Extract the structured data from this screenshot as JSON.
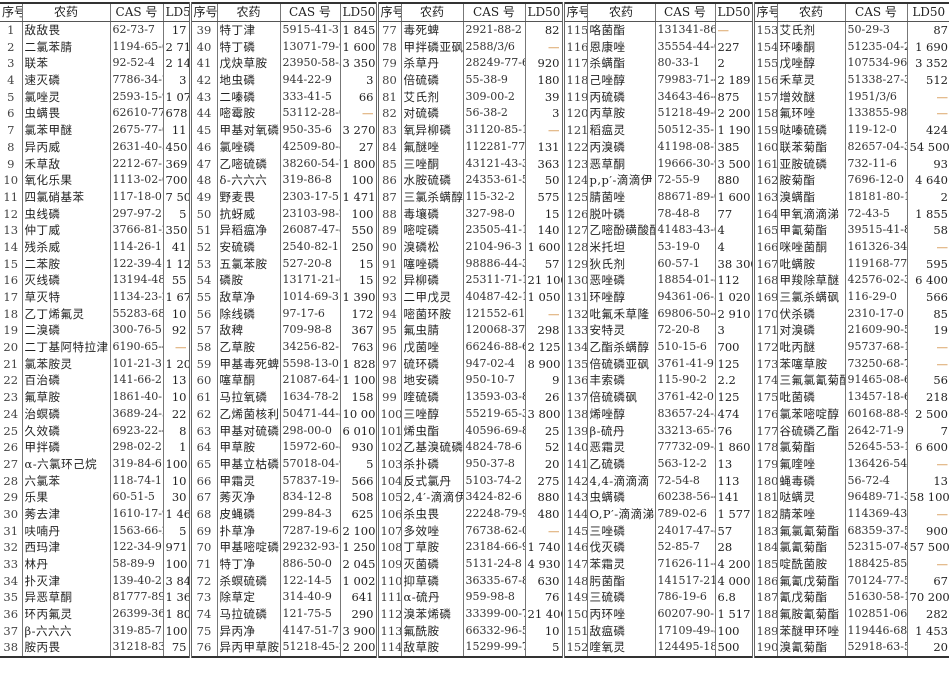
{
  "headers": {
    "no": "序号",
    "name": "农药",
    "cas": "CAS 号",
    "ld50": "LD50"
  },
  "dash_color": "#d08a3a",
  "groups": [
    [
      [
        "1",
        "敌敌畏",
        "62-73-7",
        "17"
      ],
      [
        "2",
        "二氯苯腈",
        "1194-65-6",
        "2 710"
      ],
      [
        "3",
        "联苯",
        "92-52-4",
        "2 140"
      ],
      [
        "4",
        "速灭磷",
        "7786-34-7",
        "3"
      ],
      [
        "5",
        "氯唑灵",
        "2593-15-9",
        "1 077"
      ],
      [
        "6",
        "虫螨畏",
        "62610-77-9",
        "678"
      ],
      [
        "7",
        "氯苯甲醚",
        "2675-77-6",
        "11"
      ],
      [
        "8",
        "异丙威",
        "2631-40-5",
        "450"
      ],
      [
        "9",
        "禾草敌",
        "2212-67-1",
        "369"
      ],
      [
        "10",
        "氧化乐果",
        "1113-02-6",
        "700"
      ],
      [
        "11",
        "四氯硝基苯",
        "117-18-0",
        "7 500"
      ],
      [
        "12",
        "虫线磷",
        "297-97-2",
        "5"
      ],
      [
        "13",
        "仲丁威",
        "3766-81-2",
        "350"
      ],
      [
        "14",
        "残杀威",
        "114-26-1",
        "41"
      ],
      [
        "15",
        "二苯胺",
        "122-39-4",
        "1 120"
      ],
      [
        "16",
        "灭线磷",
        "13194-48-4",
        "55"
      ],
      [
        "17",
        "草灭特",
        "1134-23-2",
        "1 678"
      ],
      [
        "18",
        "乙丁烯氟灵",
        "55283-68-6",
        "10"
      ],
      [
        "19",
        "二溴磷",
        "300-76-5",
        "92"
      ],
      [
        "20",
        "二丁基阿特拉津",
        "6190-65-4",
        "—"
      ],
      [
        "21",
        "氯苯胺灵",
        "101-21-3",
        "1 200"
      ],
      [
        "22",
        "百治磷",
        "141-66-2",
        "13"
      ],
      [
        "23",
        "氟草胺",
        "1861-40-1",
        "10"
      ],
      [
        "24",
        "治螟磷",
        "3689-24-5",
        "22"
      ],
      [
        "25",
        "久效磷",
        "6923-22-4",
        "8"
      ],
      [
        "26",
        "甲拌磷",
        "298-02-2",
        "1"
      ],
      [
        "27",
        "α-六氯环己烷",
        "319-84-6",
        "100"
      ],
      [
        "28",
        "六氯苯",
        "118-74-1",
        "10"
      ],
      [
        "29",
        "乐果",
        "60-51-5",
        "30"
      ],
      [
        "30",
        "莠去津",
        "1610-17-9",
        "1 465"
      ],
      [
        "31",
        "呋喃丹",
        "1563-66-2",
        "5"
      ],
      [
        "32",
        "西玛津",
        "122-34-9",
        "971"
      ],
      [
        "33",
        "林丹",
        "58-89-9",
        "100"
      ],
      [
        "34",
        "扑灭津",
        "139-40-2",
        "3 840"
      ],
      [
        "35",
        "异恶草酮",
        "81777-89-1",
        "1 369"
      ],
      [
        "36",
        "环丙氟灵",
        "26399-36-0",
        "1 808"
      ],
      [
        "37",
        "β-六六六",
        "319-85-7",
        "100"
      ],
      [
        "38",
        "胺丙畏",
        "31218-83-4",
        "75"
      ]
    ],
    [
      [
        "39",
        "特丁津",
        "5915-41-3",
        "1 845"
      ],
      [
        "40",
        "特丁磷",
        "13071-79-9",
        "1 600"
      ],
      [
        "41",
        "戊炔草胺",
        "23950-58-5",
        "3 350"
      ],
      [
        "42",
        "地虫磷",
        "944-22-9",
        "3"
      ],
      [
        "43",
        "二嗪磷",
        "333-41-5",
        "66"
      ],
      [
        "44",
        "嘧霉胺",
        "53112-28-0",
        "—"
      ],
      [
        "45",
        "甲基对氧磷",
        "950-35-6",
        "3 270"
      ],
      [
        "46",
        "氯唑磷",
        "42509-80-8",
        "27"
      ],
      [
        "47",
        "乙嘧硫磷",
        "38260-54-7",
        "1 800"
      ],
      [
        "48",
        "δ-六六六",
        "319-86-8",
        "100"
      ],
      [
        "49",
        "野麦畏",
        "2303-17-5",
        "1 471"
      ],
      [
        "50",
        "抗蚜威",
        "23103-98-2",
        "100"
      ],
      [
        "51",
        "异稻瘟净",
        "26087-47-8",
        "550"
      ],
      [
        "52",
        "安硫磷",
        "2540-82-1",
        "250"
      ],
      [
        "53",
        "五氯苯胺",
        "527-20-8",
        "15"
      ],
      [
        "54",
        "磷胺",
        "13171-21-6",
        "15"
      ],
      [
        "55",
        "敌草净",
        "1014-69-3",
        "1 390"
      ],
      [
        "56",
        "除线磷",
        "97-17-6",
        "172"
      ],
      [
        "57",
        "敌稗",
        "709-98-8",
        "367"
      ],
      [
        "58",
        "乙草胺",
        "34256-82-1",
        "763"
      ],
      [
        "59",
        "甲基毒死蜱",
        "5598-13-0",
        "1 828"
      ],
      [
        "60",
        "噻草酮",
        "21087-64-9",
        "1 100"
      ],
      [
        "61",
        "马拉氧磷",
        "1634-78-2",
        "158"
      ],
      [
        "62",
        "乙烯菌核利",
        "50471-44-8",
        "10 000"
      ],
      [
        "63",
        "甲基对硫磷",
        "298-00-0",
        "6 010"
      ],
      [
        "64",
        "甲草胺",
        "15972-60-8",
        "930"
      ],
      [
        "65",
        "甲基立枯磷",
        "57018-04-9",
        "5"
      ],
      [
        "66",
        "甲霜灵",
        "57837-19-1",
        "566"
      ],
      [
        "67",
        "莠灭净",
        "834-12-8",
        "508"
      ],
      [
        "68",
        "皮蝇磷",
        "299-84-3",
        "625"
      ],
      [
        "69",
        "扑草净",
        "7287-19-6",
        "2 100"
      ],
      [
        "70",
        "甲基嘧啶磷",
        "29232-93-7",
        "1 250"
      ],
      [
        "71",
        "特丁净",
        "886-50-0",
        "2 045"
      ],
      [
        "72",
        "杀螟硫磷",
        "122-14-5",
        "1 002"
      ],
      [
        "73",
        "除草定",
        "314-40-9",
        "641"
      ],
      [
        "74",
        "马拉硫磷",
        "121-75-5",
        "290"
      ],
      [
        "75",
        "异丙净",
        "4147-51-7",
        "3 900"
      ],
      [
        "76",
        "异丙甲草胺",
        "51218-45-2",
        "2 200"
      ]
    ],
    [
      [
        "77",
        "毒死蜱",
        "2921-88-2",
        "82"
      ],
      [
        "78",
        "甲拌磷亚砜",
        "2588/3/6",
        "—"
      ],
      [
        "79",
        "杀草丹",
        "28249-77-6",
        "920"
      ],
      [
        "80",
        "倍硫磷",
        "55-38-9",
        "180"
      ],
      [
        "81",
        "艾氏剂",
        "309-00-2",
        "39"
      ],
      [
        "82",
        "对硫磷",
        "56-38-2",
        "3"
      ],
      [
        "83",
        "氧异柳磷",
        "31120-85-1",
        "—"
      ],
      [
        "84",
        "氟醚唑",
        "112281-77-3",
        "131"
      ],
      [
        "85",
        "三唑酮",
        "43121-43-3",
        "363"
      ],
      [
        "86",
        "水胺硫磷",
        "24353-61-5",
        "50"
      ],
      [
        "87",
        "三氯杀螨醇",
        "115-32-2",
        "575"
      ],
      [
        "88",
        "毒壤磷",
        "327-98-0",
        "15"
      ],
      [
        "89",
        "嘧啶磷",
        "23505-41-1",
        "140"
      ],
      [
        "90",
        "溴磷松",
        "2104-96-3",
        "1 600"
      ],
      [
        "91",
        "噻唑磷",
        "98886-44-3",
        "57"
      ],
      [
        "92",
        "异柳磷",
        "25311-71-1",
        "21 100"
      ],
      [
        "93",
        "二甲戊灵",
        "40487-42-1",
        "1 050"
      ],
      [
        "94",
        "嘧菌环胺",
        "121552-61-2",
        "—"
      ],
      [
        "95",
        "氟虫腈",
        "120068-37-3",
        "298"
      ],
      [
        "96",
        "戊菌唑",
        "66246-88-6",
        "2 125"
      ],
      [
        "97",
        "硫环磷",
        "947-02-4",
        "8 900"
      ],
      [
        "98",
        "地安磷",
        "950-10-7",
        "9"
      ],
      [
        "99",
        "喹硫磷",
        "13593-03-8",
        "26"
      ],
      [
        "100",
        "三唑醇",
        "55219-65-3",
        "3 800"
      ],
      [
        "101",
        "烯虫酯",
        "40596-69-8",
        "25"
      ],
      [
        "102",
        "乙基溴硫磷",
        "4824-78-6",
        "52"
      ],
      [
        "103",
        "杀扑磷",
        "950-37-8",
        "20"
      ],
      [
        "104",
        "反式氯丹",
        "5103-74-2",
        "275"
      ],
      [
        "105",
        "2,4′-滴滴伊",
        "3424-82-6",
        "880"
      ],
      [
        "106",
        "杀虫畏",
        "22248-79-9",
        "480"
      ],
      [
        "107",
        "多效唑",
        "76738-62-0",
        "—"
      ],
      [
        "108",
        "丁草胺",
        "23184-66-9",
        "1 740"
      ],
      [
        "109",
        "灭菌磷",
        "5131-24-8",
        "4 930"
      ],
      [
        "110",
        "抑草磷",
        "36335-67-8",
        "630"
      ],
      [
        "111",
        "α-硫丹",
        "959-98-8",
        "76"
      ],
      [
        "112",
        "溴苯烯磷",
        "33399-00-7",
        "21 400"
      ],
      [
        "113",
        "氟酰胺",
        "66332-96-5",
        "10"
      ],
      [
        "114",
        "敌草胺",
        "15299-99-7",
        "5"
      ]
    ],
    [
      [
        "115",
        "咯菌酯",
        "131341-86-1",
        "—"
      ],
      [
        "116",
        "恩康唑",
        "35554-44-0",
        "227"
      ],
      [
        "117",
        "杀螨酯",
        "80-33-1",
        "2"
      ],
      [
        "118",
        "己唑醇",
        "79983-71-4",
        "2 189"
      ],
      [
        "119",
        "丙硫磷",
        "34643-46-4",
        "875"
      ],
      [
        "120",
        "丙草胺",
        "51218-49-6",
        "2 200"
      ],
      [
        "121",
        "稻瘟灵",
        "50512-35-1",
        "1 190"
      ],
      [
        "122",
        "丙溴磷",
        "41198-08-7",
        "385"
      ],
      [
        "123",
        "恶草酮",
        "19666-30-9",
        "3 500"
      ],
      [
        "124",
        "p,p′-滴滴伊",
        "72-55-9",
        "880"
      ],
      [
        "125",
        "腈菌唑",
        "88671-89-0",
        "1 600"
      ],
      [
        "126",
        "脱叶磷",
        "78-48-8",
        "77"
      ],
      [
        "127",
        "乙嘧酚磺酸酯",
        "41483-43-6",
        "4"
      ],
      [
        "128",
        "米托坦",
        "53-19-0",
        "4"
      ],
      [
        "129",
        "狄氏剂",
        "60-57-1",
        "38 300"
      ],
      [
        "130",
        "恶唑磷",
        "18854-01-8",
        "112"
      ],
      [
        "131",
        "环唑醇",
        "94361-06-5",
        "1 020"
      ],
      [
        "132",
        "吡氟禾草隆",
        "69806-50-4",
        "2 910"
      ],
      [
        "133",
        "安特灵",
        "72-20-8",
        "3"
      ],
      [
        "134",
        "乙酯杀螨醇",
        "510-15-6",
        "700"
      ],
      [
        "135",
        "倍硫磷亚砜",
        "3761-41-9",
        "125"
      ],
      [
        "136",
        "丰索磷",
        "115-90-2",
        "2.2"
      ],
      [
        "137",
        "倍硫磷砜",
        "3761-42-0",
        "125"
      ],
      [
        "138",
        "烯唑醇",
        "83657-24-3",
        "474"
      ],
      [
        "139",
        "β-硫丹",
        "33213-65-9",
        "76"
      ],
      [
        "140",
        "恶霜灵",
        "77732-09-3",
        "1 860"
      ],
      [
        "141",
        "乙硫磷",
        "563-12-2",
        "13"
      ],
      [
        "142",
        "4,4-滴滴滴",
        "72-54-8",
        "113"
      ],
      [
        "143",
        "虫螨磷",
        "60238-56-4",
        "141"
      ],
      [
        "144",
        "O,P′-滴滴涕",
        "789-02-6",
        "1 577"
      ],
      [
        "145",
        "三唑磷",
        "24017-47-8",
        "57"
      ],
      [
        "146",
        "伐灭磷",
        "52-85-7",
        "28"
      ],
      [
        "147",
        "苯霜灵",
        "71626-11-4",
        "4 200"
      ],
      [
        "148",
        "肟菌酯",
        "141517-21-7",
        "4 000"
      ],
      [
        "149",
        "三硫磷",
        "786-19-6",
        "6.8"
      ],
      [
        "150",
        "丙环唑",
        "60207-90-1",
        "1 517"
      ],
      [
        "151",
        "敌瘟磷",
        "17109-49-8",
        "100"
      ],
      [
        "152",
        "喹氧灵",
        "124495-18-7",
        "500"
      ]
    ],
    [
      [
        "153",
        "艾氏剂",
        "50-29-3",
        "87"
      ],
      [
        "154",
        "环嗪酮",
        "51235-04-2",
        "1 690"
      ],
      [
        "155",
        "戊唑醇",
        "107534-96-3",
        "3 352"
      ],
      [
        "156",
        "禾草灵",
        "51338-27-3",
        "512"
      ],
      [
        "157",
        "增效醚",
        "1951/3/6",
        "—"
      ],
      [
        "158",
        "氟环唑",
        "133855-98-8",
        "—"
      ],
      [
        "159",
        "哒嗪硫磷",
        "119-12-0",
        "424"
      ],
      [
        "160",
        "联苯菊酯",
        "82657-04-3",
        "54 500"
      ],
      [
        "161",
        "亚胺硫磷",
        "732-11-6",
        "93"
      ],
      [
        "162",
        "胺菊酯",
        "7696-12-0",
        "4 640"
      ],
      [
        "163",
        "溴螨酯",
        "18181-80-1",
        "2"
      ],
      [
        "164",
        "甲氧滴滴涕",
        "72-43-5",
        "1 855"
      ],
      [
        "165",
        "甲氰菊酯",
        "39515-41-8",
        "58"
      ],
      [
        "166",
        "咪唑菌酮",
        "161326-34-7",
        "—"
      ],
      [
        "167",
        "吡螨胺",
        "119168-77-3",
        "595"
      ],
      [
        "168",
        "甲羧除草醚",
        "42576-02-3",
        "6 400"
      ],
      [
        "169",
        "三氯杀螨砜",
        "116-29-0",
        "566"
      ],
      [
        "170",
        "伏杀磷",
        "2310-17-0",
        "85"
      ],
      [
        "171",
        "对溴磷",
        "21609-90-5",
        "19"
      ],
      [
        "172",
        "吡丙醚",
        "95737-68-1",
        "—"
      ],
      [
        "173",
        "苯噻草胺",
        "73250-68-7",
        "—"
      ],
      [
        "174",
        "三氟氯氰菊酯",
        "91465-08-6",
        "56"
      ],
      [
        "175",
        "吡菌磷",
        "13457-18-6",
        "218"
      ],
      [
        "176",
        "氯苯嘧啶醇",
        "60168-88-9",
        "2 500"
      ],
      [
        "177",
        "谷硫磷乙酯",
        "2642-71-9",
        "7"
      ],
      [
        "178",
        "氯菊酯",
        "52645-53-1",
        "6 600"
      ],
      [
        "179",
        "氟喹唑",
        "136426-54-5",
        "—"
      ],
      [
        "180",
        "蝇毒磷",
        "56-72-4",
        "13"
      ],
      [
        "181",
        "哒螨灵",
        "96489-71-3",
        "58 100"
      ],
      [
        "182",
        "腈苯唑",
        "114369-43-6",
        "—"
      ],
      [
        "183",
        "氟氯氰菊酯",
        "68359-37-5",
        "900"
      ],
      [
        "184",
        "氯氰菊酯",
        "52315-07-8",
        "57 500"
      ],
      [
        "185",
        "啶酰菌胺",
        "188425-85-6",
        "—"
      ],
      [
        "186",
        "氟氰戊菊酯",
        "70124-77-5",
        "67"
      ],
      [
        "187",
        "氰戊菊酯",
        "51630-58-1",
        "70 200"
      ],
      [
        "188",
        "氟胺氰菊酯",
        "102851-06-9",
        "282"
      ],
      [
        "189",
        "苯醚甲环唑",
        "119446-68-3",
        "1 453"
      ],
      [
        "190",
        "溴氰菊酯",
        "52918-63-5",
        "20"
      ]
    ]
  ]
}
